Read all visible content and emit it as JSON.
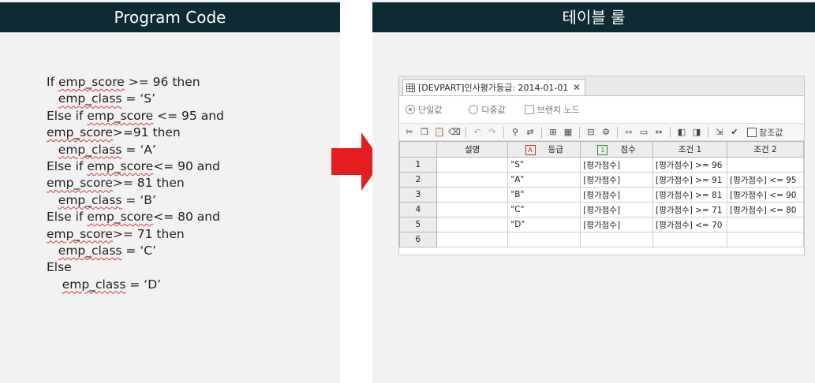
{
  "left_panel": {
    "title": "Program Code",
    "code_lines": [
      {
        "indent": "",
        "parts": [
          {
            "t": "If "
          },
          {
            "t": "emp_score",
            "w": true
          },
          {
            "t": " >= 96 then"
          }
        ]
      },
      {
        "indent": "   ",
        "parts": [
          {
            "t": "emp_class",
            "w": true
          },
          {
            "t": " = ‘S’"
          }
        ]
      },
      {
        "indent": "",
        "parts": [
          {
            "t": "Else if "
          },
          {
            "t": "emp_score",
            "w": true
          },
          {
            "t": " <= 95 and"
          }
        ]
      },
      {
        "indent": "",
        "parts": [
          {
            "t": "emp_score",
            "w": true
          },
          {
            "t": ">=91 then"
          }
        ]
      },
      {
        "indent": "   ",
        "parts": [
          {
            "t": "emp_class",
            "w": true
          },
          {
            "t": " = ‘A’"
          }
        ]
      },
      {
        "indent": "",
        "parts": [
          {
            "t": "Else if "
          },
          {
            "t": "emp_score",
            "w": true
          },
          {
            "t": "<= 90 and"
          }
        ]
      },
      {
        "indent": "",
        "parts": [
          {
            "t": "emp_score",
            "w": true
          },
          {
            "t": ">= 81 then"
          }
        ]
      },
      {
        "indent": "   ",
        "parts": [
          {
            "t": "emp_class",
            "w": true
          },
          {
            "t": " = ‘B’"
          }
        ]
      },
      {
        "indent": "",
        "parts": [
          {
            "t": "Else if "
          },
          {
            "t": "emp_score",
            "w": true
          },
          {
            "t": "<= 80 and"
          }
        ]
      },
      {
        "indent": "",
        "parts": [
          {
            "t": "emp_score",
            "w": true
          },
          {
            "t": ">= 71 then"
          }
        ]
      },
      {
        "indent": "   ",
        "parts": [
          {
            "t": "emp_class",
            "w": true
          },
          {
            "t": " = ‘C’"
          }
        ]
      },
      {
        "indent": "",
        "parts": [
          {
            "t": "Else"
          }
        ]
      },
      {
        "indent": "    ",
        "parts": [
          {
            "t": "emp_class",
            "w": true
          },
          {
            "t": " = ‘D’"
          }
        ]
      }
    ]
  },
  "arrow_color": "#e41e1e",
  "right_panel": {
    "title": "테이블 룰",
    "tab": {
      "label": "[DEVPART]인사평가등급: 2014-01-01",
      "close": "✕",
      "icon": "table-icon"
    },
    "options": {
      "single": "단일값",
      "multi": "다중값",
      "branch": "브랜치 노드"
    },
    "toolbar": {
      "ref_label": "참조값"
    },
    "grid": {
      "headers": [
        "설명",
        "등급",
        "점수",
        "조건 1",
        "조건 2"
      ],
      "header_icons": [
        "",
        "A",
        "1",
        "",
        ""
      ],
      "rows": [
        [
          "1",
          "",
          "\"S\"",
          "[평가점수]",
          "[평가점수] >= 96",
          ""
        ],
        [
          "2",
          "",
          "\"A\"",
          "[평가점수]",
          "[평가점수] >= 91",
          "[평가점수] <= 95"
        ],
        [
          "3",
          "",
          "\"B\"",
          "[평가점수]",
          "[평가점수] >= 81",
          "[평가점수] <= 90"
        ],
        [
          "4",
          "",
          "\"C\"",
          "[평가점수]",
          "[평가점수] >= 71",
          "[평가점수] <= 80"
        ],
        [
          "5",
          "",
          "\"D\"",
          "[평가점수]",
          "[평가점수] <= 70",
          ""
        ],
        [
          "6",
          "",
          "",
          "",
          "",
          ""
        ]
      ]
    }
  }
}
